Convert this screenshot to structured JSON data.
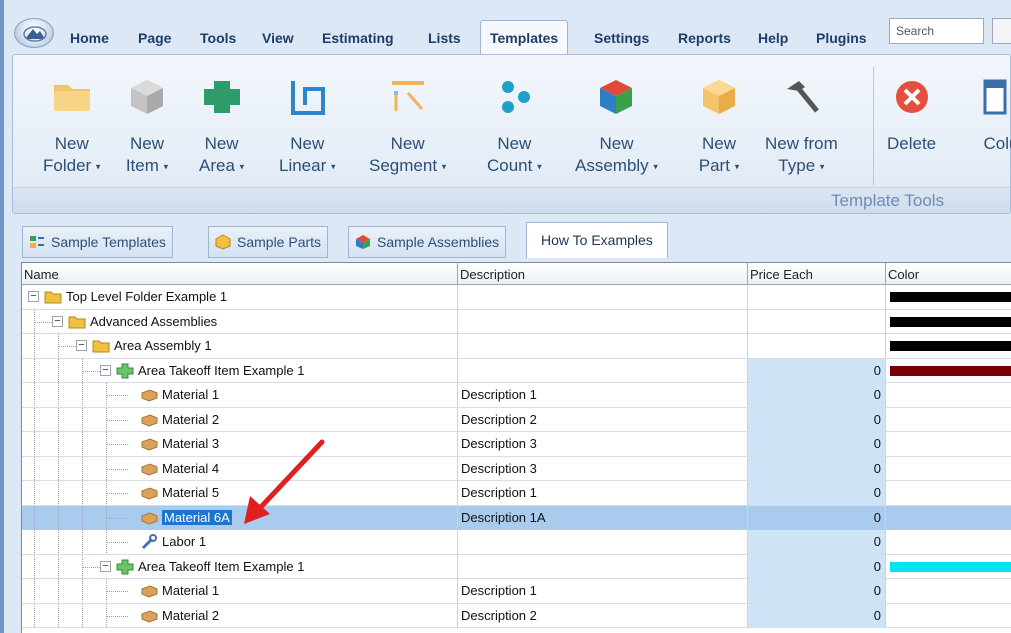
{
  "menu": {
    "items": [
      "Home",
      "Page",
      "Tools",
      "View",
      "Estimating",
      "Lists",
      "Templates",
      "Settings",
      "Reports",
      "Help",
      "Plugins"
    ],
    "active": "Templates",
    "search_placeholder": "Search"
  },
  "ribbon": {
    "buttons": [
      {
        "line1": "New",
        "line2": "Folder",
        "dropdown": true,
        "icon": "folder-icon",
        "color": "#f0c56a"
      },
      {
        "line1": "New",
        "line2": "Item",
        "dropdown": true,
        "icon": "item-cube-icon",
        "color": "#b5b5b5"
      },
      {
        "line1": "New",
        "line2": "Area",
        "dropdown": true,
        "icon": "area-icon",
        "color": "#2f9a6a"
      },
      {
        "line1": "New",
        "line2": "Linear",
        "dropdown": true,
        "icon": "linear-icon",
        "color": "#2e86c9"
      },
      {
        "line1": "New",
        "line2": "Segment",
        "dropdown": true,
        "icon": "segment-icon",
        "color": "#f2b45a"
      },
      {
        "line1": "New",
        "line2": "Count",
        "dropdown": true,
        "icon": "count-icon",
        "color": "#1fa0c8"
      },
      {
        "line1": "New",
        "line2": "Assembly",
        "dropdown": true,
        "icon": "assembly-icon",
        "color": "#e04a3a"
      },
      {
        "line1": "New",
        "line2": "Part",
        "dropdown": true,
        "icon": "part-icon",
        "color": "#f5c46a"
      },
      {
        "line1": "New from",
        "line2": "Type",
        "dropdown": true,
        "icon": "hammer-icon",
        "color": "#555555"
      },
      {
        "line1": "Delete",
        "line2": "",
        "dropdown": false,
        "icon": "delete-icon",
        "color": "#e4503f"
      },
      {
        "line1": "Colu",
        "line2": "",
        "dropdown": false,
        "icon": "columns-icon",
        "color": "#3a6ea8"
      }
    ],
    "group_label": "Template Tools"
  },
  "tabs": [
    {
      "label": "Sample Templates",
      "icon": "templates-icon",
      "active": false
    },
    {
      "label": "Sample Parts",
      "icon": "parts-icon",
      "active": false
    },
    {
      "label": "Sample Assemblies",
      "icon": "assemblies-icon",
      "active": false
    },
    {
      "label": "How To Examples",
      "icon": "",
      "active": true
    }
  ],
  "grid": {
    "columns": [
      "Name",
      "Description",
      "Price Each",
      "Color"
    ],
    "rows": [
      {
        "level": 0,
        "type": "folder",
        "name": "Top Level Folder Example 1",
        "desc": "",
        "price": "",
        "color": "#000000",
        "expand": true
      },
      {
        "level": 1,
        "type": "folder",
        "name": "Advanced Assemblies",
        "desc": "",
        "price": "",
        "color": "#000000",
        "expand": true
      },
      {
        "level": 2,
        "type": "folder",
        "name": "Area Assembly 1",
        "desc": "",
        "price": "",
        "color": "#000000",
        "expand": true
      },
      {
        "level": 3,
        "type": "area",
        "name": "Area Takeoff Item Example 1",
        "desc": "",
        "price": "0",
        "color": "#7a0000",
        "expand": true
      },
      {
        "level": 4,
        "type": "material",
        "name": "Material 1",
        "desc": "Description 1",
        "price": "0",
        "color": ""
      },
      {
        "level": 4,
        "type": "material",
        "name": "Material 2",
        "desc": "Description 2",
        "price": "0",
        "color": ""
      },
      {
        "level": 4,
        "type": "material",
        "name": "Material 3",
        "desc": "Description 3",
        "price": "0",
        "color": ""
      },
      {
        "level": 4,
        "type": "material",
        "name": "Material 4",
        "desc": "Description 3",
        "price": "0",
        "color": ""
      },
      {
        "level": 4,
        "type": "material",
        "name": "Material 5",
        "desc": "Description 1",
        "price": "0",
        "color": ""
      },
      {
        "level": 4,
        "type": "material",
        "name": "Material 6A",
        "desc": "Description 1A",
        "price": "0",
        "color": "",
        "selected": true
      },
      {
        "level": 4,
        "type": "labor",
        "name": "Labor 1",
        "desc": "",
        "price": "0",
        "color": ""
      },
      {
        "level": 3,
        "type": "area",
        "name": "Area Takeoff Item Example 1",
        "desc": "",
        "price": "0",
        "color": "#00e5f0",
        "expand": true
      },
      {
        "level": 4,
        "type": "material",
        "name": "Material 1",
        "desc": "Description 1",
        "price": "0",
        "color": ""
      },
      {
        "level": 4,
        "type": "material",
        "name": "Material 2",
        "desc": "Description 2",
        "price": "0",
        "color": ""
      }
    ]
  },
  "annotation": {
    "color": "#e02020"
  }
}
